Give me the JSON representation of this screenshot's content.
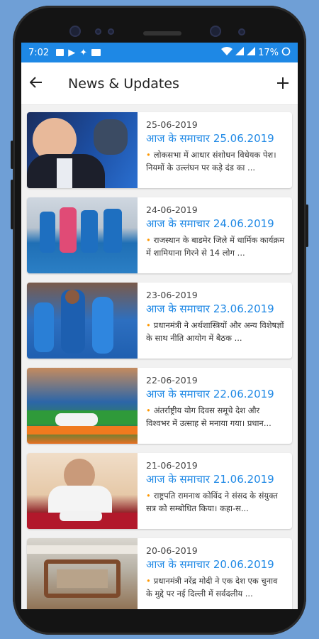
{
  "status_bar": {
    "time": "7:02",
    "battery": "17%"
  },
  "app_bar": {
    "back_icon": "arrow-left-icon",
    "title": "News & Updates",
    "add_icon": "plus-icon"
  },
  "news": [
    {
      "date": "25-06-2019",
      "title": "आज के समाचार 25.06.2019",
      "bullet": "•",
      "desc": "लोकसभा में आधार संशोधन विधेयक पेश। नियमों के उल्लंघन पर कड़े दंड का ..."
    },
    {
      "date": "24-06-2019",
      "title": "आज के समाचार 24.06.2019",
      "bullet": "•",
      "desc": "राजस्थान के बाडमेर जिले में धार्मिक कार्यक्रम में शामियाना गिरने से 14 लोग ..."
    },
    {
      "date": "23-06-2019",
      "title": "आज के समाचार 23.06.2019",
      "bullet": "•",
      "desc": "प्रधानमंत्री ने अर्थशास्त्रियों और अन्य विशेषज्ञों के साथ नीति आयोग में  बैठक ..."
    },
    {
      "date": "22-06-2019",
      "title": "आज के समाचार 22.06.2019",
      "bullet": "•",
      "desc": "अंतर्राष्ट्रीय योग दिवस समूचे देश और विश्वभर में उत्साह से मनाया गया। प्रधान..."
    },
    {
      "date": "21-06-2019",
      "title": "आज के समाचार 21.06.2019",
      "bullet": "•",
      "desc": "राष्ट्रपति रामनाथ कोविंद ने संसद के संयुक्त सत्र को सम्बोधित किया। कहा-स..."
    },
    {
      "date": "20-06-2019",
      "title": "आज के समाचार 20.06.2019",
      "bullet": "•",
      "desc": "प्रधानमंत्री नरेंद्र मोदी ने एक देश एक चुनाव के मुद्दे पर नई दिल्ली में सर्वदलीय ..."
    }
  ],
  "colors": {
    "accent": "#1e88e5",
    "bullet": "#ff9800"
  }
}
